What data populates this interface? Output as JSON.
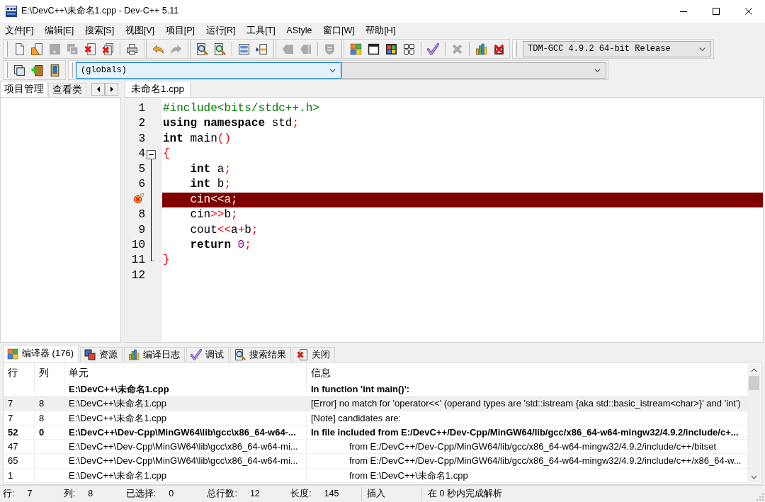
{
  "window": {
    "title": "E:\\DevC++\\未命名1.cpp - Dev-C++ 5.11"
  },
  "menu": [
    "文件[F]",
    "编辑[E]",
    "搜索[S]",
    "视图[V]",
    "项目[P]",
    "运行[R]",
    "工具[T]",
    "AStyle",
    "窗口[W]",
    "帮助[H]"
  ],
  "toolbars": [
    {
      "items": [
        {
          "kind": "new",
          "disabled": false
        },
        {
          "kind": "open",
          "disabled": false
        },
        {
          "kind": "save",
          "disabled": true
        },
        {
          "kind": "saveall",
          "disabled": true
        },
        {
          "kind": "close",
          "disabled": false
        },
        {
          "kind": "closeall",
          "disabled": false
        },
        {
          "kind": "separator"
        },
        {
          "kind": "print",
          "disabled": false
        },
        {
          "kind": "band"
        },
        {
          "kind": "undo",
          "disabled": false
        },
        {
          "kind": "redo",
          "disabled": true
        },
        {
          "kind": "band"
        },
        {
          "kind": "find",
          "disabled": false
        },
        {
          "kind": "replace",
          "disabled": false
        },
        {
          "kind": "separator"
        },
        {
          "kind": "indent",
          "disabled": false
        },
        {
          "kind": "unindent",
          "disabled": false
        },
        {
          "kind": "band"
        },
        {
          "kind": "back",
          "disabled": true
        },
        {
          "kind": "forward",
          "disabled": true
        },
        {
          "kind": "separator"
        },
        {
          "kind": "bookmark",
          "disabled": true
        },
        {
          "kind": "band"
        },
        {
          "kind": "compile",
          "disabled": false
        },
        {
          "kind": "run",
          "disabled": false
        },
        {
          "kind": "compilerun",
          "disabled": false
        },
        {
          "kind": "rebuild",
          "disabled": false
        },
        {
          "kind": "separator"
        },
        {
          "kind": "check",
          "disabled": false
        },
        {
          "kind": "separator"
        },
        {
          "kind": "stop",
          "disabled": true
        },
        {
          "kind": "separator"
        },
        {
          "kind": "profile",
          "disabled": false
        },
        {
          "kind": "delprofile",
          "disabled": false
        }
      ],
      "compiler_combo": {
        "value": "TDM-GCC 4.9.2 64-bit Release",
        "focused": false
      }
    },
    {
      "items": [
        {
          "kind": "frame",
          "disabled": false
        },
        {
          "kind": "add",
          "disabled": false
        },
        {
          "kind": "book",
          "disabled": false
        }
      ],
      "combos": [
        {
          "value": "(globals)",
          "focused": true
        },
        {
          "focused": false
        }
      ]
    }
  ],
  "project_panel": {
    "tabs": [
      {
        "label": "项目管理",
        "selected": true
      },
      {
        "label": "查看类",
        "selected": false
      }
    ]
  },
  "editor": {
    "tabs": [
      {
        "label": "未命名1.cpp",
        "selected": true
      }
    ],
    "lines": [
      {
        "number": "1",
        "error": false,
        "fold_start": false,
        "fold_end": false,
        "tokens": [
          {
            "text": "#include<bits/stdc++.h>",
            "kind": "preprocessor"
          }
        ]
      },
      {
        "number": "2",
        "error": false,
        "fold_start": false,
        "fold_end": false,
        "tokens": [
          {
            "text": "using namespace",
            "kind": "keyword"
          },
          {
            "text": " std",
            "kind": "plain"
          },
          {
            "text": ";",
            "kind": "symbol"
          }
        ]
      },
      {
        "number": "3",
        "error": false,
        "fold_start": false,
        "fold_end": false,
        "tokens": [
          {
            "text": "int",
            "kind": "keyword"
          },
          {
            "text": " main",
            "kind": "plain"
          },
          {
            "text": "()",
            "kind": "symbol"
          }
        ]
      },
      {
        "number": "4",
        "error": false,
        "fold_start": true,
        "fold_end": false,
        "tokens": [
          {
            "text": "{",
            "kind": "symbol"
          }
        ]
      },
      {
        "number": "5",
        "error": false,
        "fold_start": false,
        "fold_end": false,
        "tokens": [
          {
            "text": "    int",
            "kind": "keyword"
          },
          {
            "text": " a",
            "kind": "plain"
          },
          {
            "text": ";",
            "kind": "symbol"
          }
        ]
      },
      {
        "number": "6",
        "error": false,
        "fold_start": false,
        "fold_end": false,
        "tokens": [
          {
            "text": "    int",
            "kind": "keyword"
          },
          {
            "text": " b",
            "kind": "plain"
          },
          {
            "text": ";",
            "kind": "symbol"
          }
        ]
      },
      {
        "error": true,
        "fold_start": false,
        "fold_end": false,
        "tokens": [
          {
            "text": "    cin",
            "kind": "plain"
          },
          {
            "text": "<<",
            "kind": "symbol"
          },
          {
            "text": "a",
            "kind": "plain"
          },
          {
            "text": ";",
            "kind": "symbol"
          }
        ]
      },
      {
        "number": "8",
        "error": false,
        "fold_start": false,
        "fold_end": false,
        "tokens": [
          {
            "text": "    cin",
            "kind": "plain"
          },
          {
            "text": ">>",
            "kind": "symbol"
          },
          {
            "text": "b",
            "kind": "plain"
          },
          {
            "text": ";",
            "kind": "symbol"
          }
        ]
      },
      {
        "number": "9",
        "error": false,
        "fold_start": false,
        "fold_end": false,
        "tokens": [
          {
            "text": "    cout",
            "kind": "plain"
          },
          {
            "text": "<<",
            "kind": "symbol"
          },
          {
            "text": "a",
            "kind": "plain"
          },
          {
            "text": "+",
            "kind": "symbol"
          },
          {
            "text": "b",
            "kind": "plain"
          },
          {
            "text": ";",
            "kind": "symbol"
          }
        ]
      },
      {
        "number": "10",
        "error": false,
        "fold_start": false,
        "fold_end": false,
        "tokens": [
          {
            "text": "    return",
            "kind": "keyword"
          },
          {
            "text": " 0",
            "kind": "number"
          },
          {
            "text": ";",
            "kind": "symbol"
          }
        ]
      },
      {
        "number": "11",
        "error": false,
        "fold_start": false,
        "fold_end": true,
        "tokens": [
          {
            "text": "}",
            "kind": "symbol"
          }
        ]
      },
      {
        "number": "12",
        "error": false,
        "fold_start": false,
        "fold_end": false
      }
    ]
  },
  "output_panel": {
    "tabs": [
      {
        "label": "编译器 (176)",
        "kind": "compiler",
        "selected": true
      },
      {
        "label": "资源",
        "kind": "resources",
        "selected": false
      },
      {
        "label": "编译日志",
        "kind": "log",
        "selected": false
      },
      {
        "label": "调试",
        "kind": "debug",
        "selected": false
      },
      {
        "label": "搜索结果",
        "kind": "search",
        "selected": false
      },
      {
        "label": "关闭",
        "kind": "close",
        "selected": false
      }
    ],
    "table": {
      "columns": [
        "行",
        "列",
        "单元",
        "信息"
      ],
      "rows": [
        {
          "unit": "E:\\DevC++\\未命名1.cpp",
          "message": "In function 'int main()':",
          "bold": true,
          "selected": false,
          "indented": false
        },
        {
          "line": "7",
          "column": "8",
          "unit": "E:\\DevC++\\未命名1.cpp",
          "message": "[Error] no match for 'operator<<' (operand types are 'std::istream {aka std::basic_istream<char>}' and 'int')",
          "bold": false,
          "selected": true,
          "indented": false
        },
        {
          "line": "7",
          "column": "8",
          "unit": "E:\\DevC++\\未命名1.cpp",
          "message": "[Note] candidates are:",
          "bold": false,
          "selected": false,
          "indented": false
        },
        {
          "line": "52",
          "column": "0",
          "unit": "E:\\DevC++\\Dev-Cpp\\MinGW64\\lib\\gcc\\x86_64-w64-...",
          "message": "In file included from E:/DevC++/Dev-Cpp/MinGW64/lib/gcc/x86_64-w64-mingw32/4.9.2/include/c+...",
          "bold": true,
          "selected": false,
          "indented": false
        },
        {
          "line": "47",
          "unit": "E:\\DevC++\\Dev-Cpp\\MinGW64\\lib\\gcc\\x86_64-w64-mi...",
          "message": "from E:/DevC++/Dev-Cpp/MinGW64/lib/gcc/x86_64-w64-mingw32/4.9.2/include/c++/bitset",
          "bold": false,
          "selected": false,
          "indented": true
        },
        {
          "line": "65",
          "unit": "E:\\DevC++\\Dev-Cpp\\MinGW64\\lib\\gcc\\x86_64-w64-mi...",
          "message": "from E:/DevC++/Dev-Cpp/MinGW64/lib/gcc/x86_64-w64-mingw32/4.9.2/include/c++/x86_64-w...",
          "bold": false,
          "selected": false,
          "indented": true
        },
        {
          "line": "1",
          "unit": "E:\\DevC++\\未命名1.cpp",
          "message": "from E:\\DevC++\\未命名1.cpp",
          "bold": false,
          "selected": false,
          "indented": true
        }
      ]
    }
  },
  "status_bar": {
    "fields": [
      {
        "label": "行:",
        "value": "7"
      },
      {
        "label": "列:",
        "value": "8"
      },
      {
        "label": "已选择:",
        "value": "0"
      },
      {
        "label": "总行数:",
        "value": "12"
      },
      {
        "label": "长度:",
        "value": "145"
      }
    ],
    "mode": "插入",
    "message": "在 0 秒内完成解析"
  }
}
